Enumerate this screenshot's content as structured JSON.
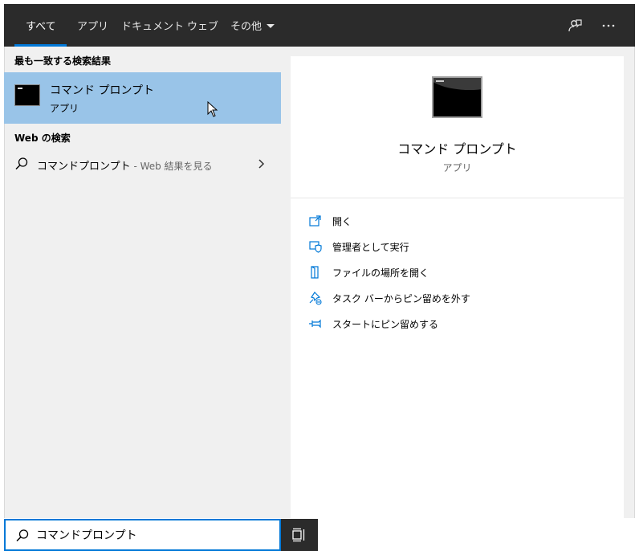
{
  "tabs": [
    {
      "label": "すべて",
      "active": true
    },
    {
      "label": "アプリ"
    },
    {
      "label": "ドキュメント"
    },
    {
      "label": "ウェブ"
    },
    {
      "label": "その他"
    }
  ],
  "left": {
    "best_match_heading": "最も一致する検索結果",
    "best_match": {
      "title": "コマンド プロンプト",
      "subtitle": "アプリ"
    },
    "web_heading": "Web の検索",
    "web_result": {
      "query": "コマンドプロンプト",
      "suffix": " - Web 結果を見る"
    }
  },
  "right": {
    "title": "コマンド プロンプト",
    "subtitle": "アプリ",
    "actions": [
      {
        "label": "開く",
        "icon": "open-icon"
      },
      {
        "label": "管理者として実行",
        "icon": "shield-icon"
      },
      {
        "label": "ファイルの場所を開く",
        "icon": "file-location-icon"
      },
      {
        "label": "タスク バーからピン留めを外す",
        "icon": "unpin-taskbar-icon"
      },
      {
        "label": "スタートにピン留めする",
        "icon": "pin-start-icon"
      }
    ]
  },
  "search": {
    "value": "コマンドプロンプト"
  },
  "colors": {
    "accent": "#0078d7",
    "selected": "#99c4e8",
    "tabbar": "#2b2b2b"
  }
}
